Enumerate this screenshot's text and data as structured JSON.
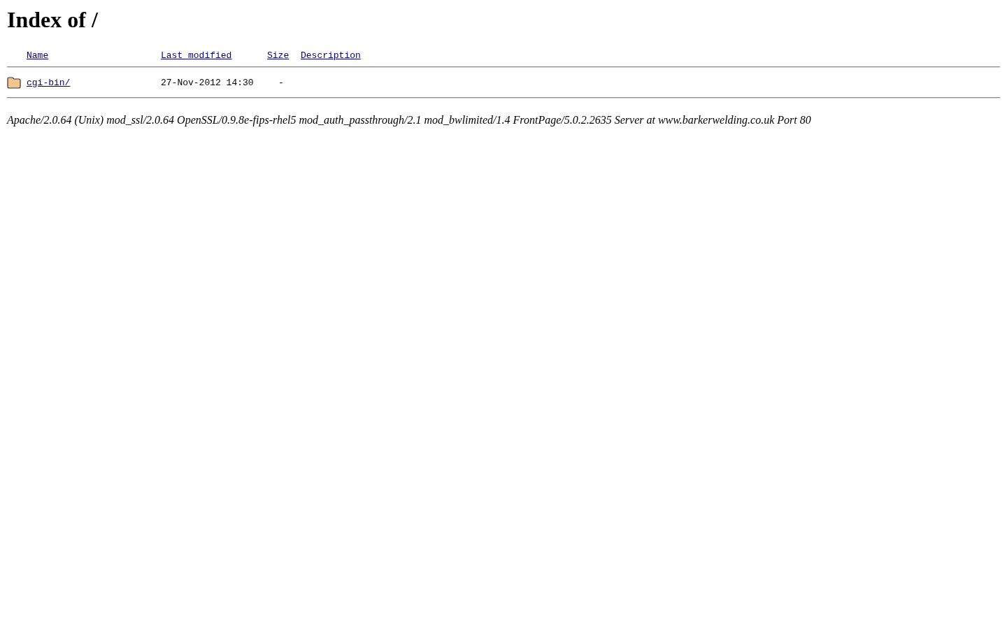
{
  "title": "Index of /",
  "columns": [
    "Name",
    "Last modified",
    "Size",
    "Description"
  ],
  "rows": [
    {
      "kind": "folder",
      "name": "cgi-bin/",
      "modified": "27-Nov-2012 14:30",
      "size": "-"
    }
  ],
  "footer": "Apache/2.0.64 (Unix) mod_ssl/2.0.64 OpenSSL/0.9.8e-fips-rhel5 mod_auth_passthrough/2.1 mod_bwlimited/1.4 FrontPage/5.0.2.2635 Server at www.barkerwelding.co.uk Port 80"
}
